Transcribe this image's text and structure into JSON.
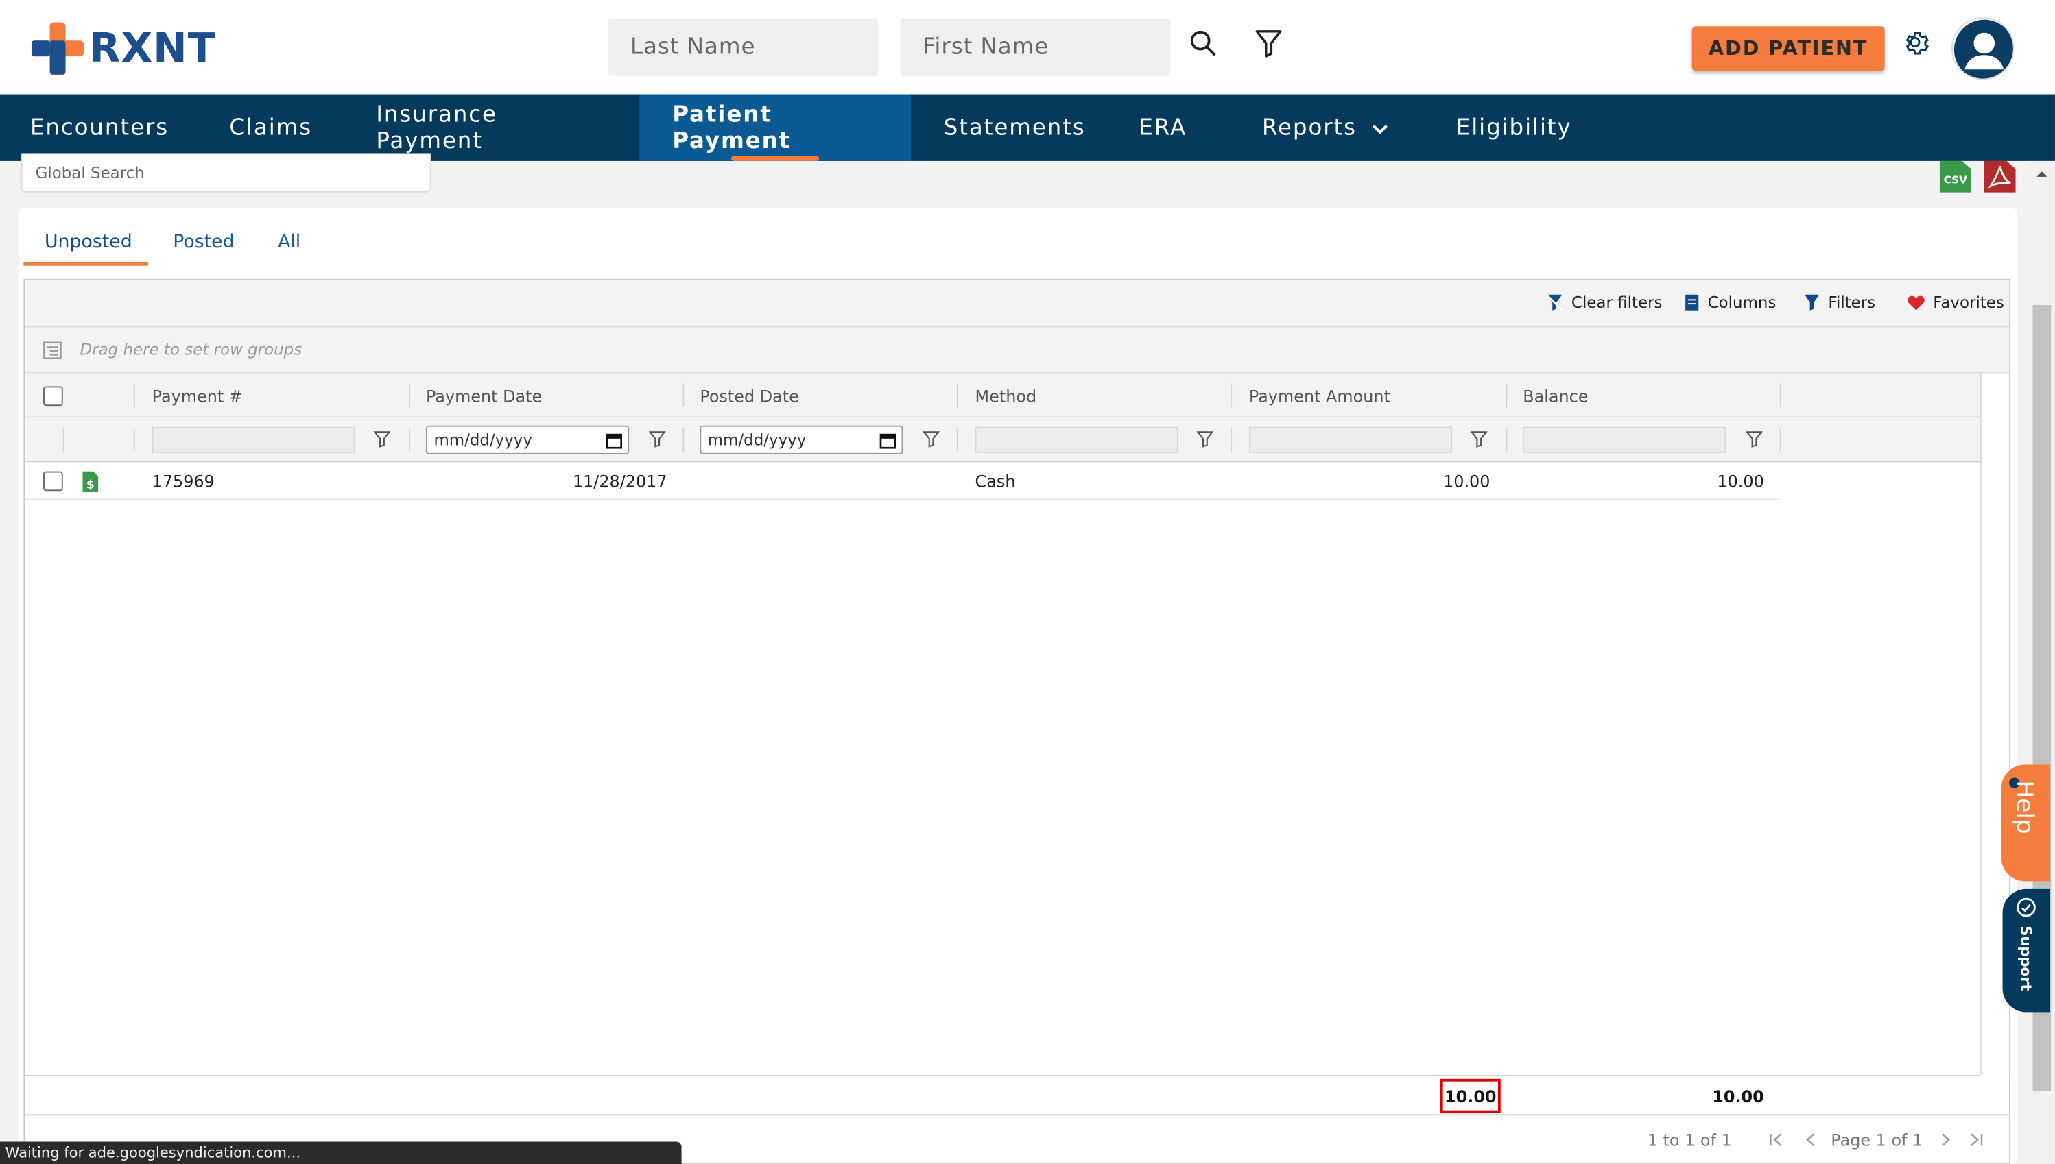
{
  "brand": {
    "name": "RXNT"
  },
  "header": {
    "last_name_placeholder": "Last Name",
    "first_name_placeholder": "First Name",
    "add_patient_label": "ADD PATIENT"
  },
  "nav": {
    "items": [
      {
        "label": "Encounters"
      },
      {
        "label": "Claims"
      },
      {
        "label": "Insurance Payment"
      },
      {
        "label": "Patient Payment",
        "active": true
      },
      {
        "label": "Statements"
      },
      {
        "label": "ERA"
      },
      {
        "label": "Reports"
      },
      {
        "label": "Eligibility"
      }
    ]
  },
  "search": {
    "global_placeholder": "Global Search"
  },
  "export": {
    "csv_label": "CSV"
  },
  "tabs": [
    {
      "label": "Unposted",
      "active": true
    },
    {
      "label": "Posted"
    },
    {
      "label": "All"
    }
  ],
  "toolbar": {
    "clear_filters": "Clear filters",
    "columns": "Columns",
    "filters": "Filters",
    "favorites": "Favorites"
  },
  "row_group_hint": "Drag here to set row groups",
  "columns": {
    "payment_no": "Payment #",
    "payment_date": "Payment Date",
    "posted_date": "Posted Date",
    "method": "Method",
    "payment_amount": "Payment Amount",
    "balance": "Balance"
  },
  "filters": {
    "date_placeholder": "mm/dd/yyyy"
  },
  "rows": [
    {
      "payment_no": "175969",
      "payment_date": "11/28/2017",
      "posted_date": "",
      "method": "Cash",
      "payment_amount": "10.00",
      "balance": "10.00"
    }
  ],
  "totals": {
    "payment_amount": "10.00",
    "balance": "10.00"
  },
  "pager": {
    "range": "1 to 1 of 1",
    "page": "Page 1 of 1"
  },
  "status_bar": "Waiting for ade.googlesyndication.com...",
  "side_tabs": {
    "help": "Help",
    "support": "Support"
  },
  "colors": {
    "brand_navy": "#063a5c",
    "accent_orange": "#f47c3c",
    "active_nav": "#0c5a93"
  }
}
